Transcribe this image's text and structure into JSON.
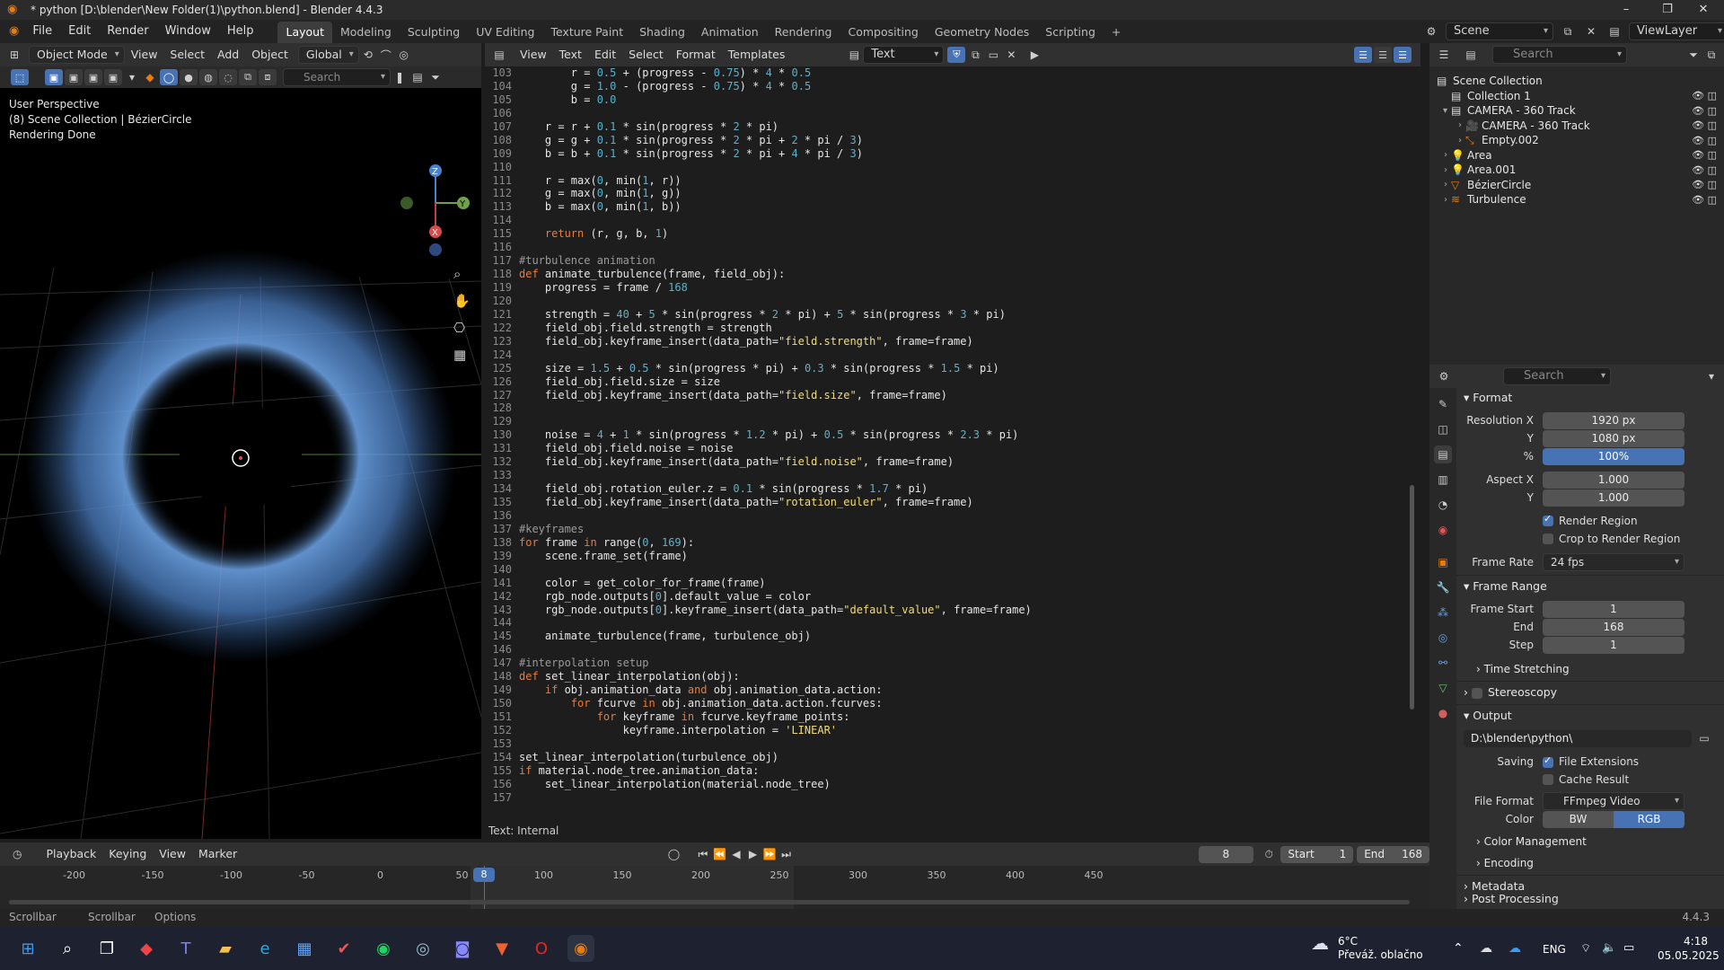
{
  "window": {
    "title": "* python [D:\\blender\\New Folder(1)\\python.blend] - Blender 4.4.3",
    "minimize": "–",
    "maximize": "❐",
    "close": "✕"
  },
  "menu": [
    "File",
    "Edit",
    "Render",
    "Window",
    "Help"
  ],
  "workspaces": [
    "Layout",
    "Modeling",
    "Sculpting",
    "UV Editing",
    "Texture Paint",
    "Shading",
    "Animation",
    "Rendering",
    "Compositing",
    "Geometry Nodes",
    "Scripting"
  ],
  "active_workspace": "Layout",
  "scene": {
    "label": "Scene",
    "view_layer": "ViewLayer"
  },
  "viewport": {
    "mode": "Object Mode",
    "menus": [
      "View",
      "Select",
      "Add",
      "Object"
    ],
    "orientation": "Global",
    "search_placeholder": "Search",
    "overlay_lines": [
      "User Perspective",
      "(8) Scene Collection | BézierCircle",
      "Rendering Done"
    ]
  },
  "text_editor": {
    "menus": [
      "View",
      "Text",
      "Edit",
      "Select",
      "Format",
      "Templates"
    ],
    "datablock": "Text",
    "footer": "Text: Internal"
  },
  "code_lines": [
    {
      "n": "103",
      "t": "        r = 0.5 + (progress - 0.75) * 4 * 0.5"
    },
    {
      "n": "104",
      "t": "        g = 1.0 - (progress - 0.75) * 4 * 0.5"
    },
    {
      "n": "105",
      "t": "        b = 0.0"
    },
    {
      "n": "106",
      "t": ""
    },
    {
      "n": "107",
      "t": "    r = r + 0.1 * sin(progress * 2 * pi)"
    },
    {
      "n": "108",
      "t": "    g = g + 0.1 * sin(progress * 2 * pi + 2 * pi / 3)"
    },
    {
      "n": "109",
      "t": "    b = b + 0.1 * sin(progress * 2 * pi + 4 * pi / 3)"
    },
    {
      "n": "110",
      "t": ""
    },
    {
      "n": "111",
      "t": "    r = max(0, min(1, r))"
    },
    {
      "n": "112",
      "t": "    g = max(0, min(1, g))"
    },
    {
      "n": "113",
      "t": "    b = max(0, min(1, b))"
    },
    {
      "n": "114",
      "t": ""
    },
    {
      "n": "115",
      "t": "    return (r, g, b, 1)"
    },
    {
      "n": "116",
      "t": ""
    },
    {
      "n": "117",
      "t": "#turbulence animation"
    },
    {
      "n": "118",
      "t": "def animate_turbulence(frame, field_obj):"
    },
    {
      "n": "119",
      "t": "    progress = frame / 168"
    },
    {
      "n": "120",
      "t": ""
    },
    {
      "n": "121",
      "t": "    strength = 40 + 5 * sin(progress * 2 * pi) + 5 * sin(progress * 3 * pi)"
    },
    {
      "n": "122",
      "t": "    field_obj.field.strength = strength"
    },
    {
      "n": "123",
      "t": "    field_obj.keyframe_insert(data_path=\"field.strength\", frame=frame)"
    },
    {
      "n": "124",
      "t": ""
    },
    {
      "n": "125",
      "t": "    size = 1.5 + 0.5 * sin(progress * pi) + 0.3 * sin(progress * 1.5 * pi)"
    },
    {
      "n": "126",
      "t": "    field_obj.field.size = size"
    },
    {
      "n": "127",
      "t": "    field_obj.keyframe_insert(data_path=\"field.size\", frame=frame)"
    },
    {
      "n": "128",
      "t": ""
    },
    {
      "n": "129",
      "t": ""
    },
    {
      "n": "130",
      "t": "    noise = 4 + 1 * sin(progress * 1.2 * pi) + 0.5 * sin(progress * 2.3 * pi)"
    },
    {
      "n": "131",
      "t": "    field_obj.field.noise = noise"
    },
    {
      "n": "132",
      "t": "    field_obj.keyframe_insert(data_path=\"field.noise\", frame=frame)"
    },
    {
      "n": "133",
      "t": ""
    },
    {
      "n": "134",
      "t": "    field_obj.rotation_euler.z = 0.1 * sin(progress * 1.7 * pi)"
    },
    {
      "n": "135",
      "t": "    field_obj.keyframe_insert(data_path=\"rotation_euler\", frame=frame)"
    },
    {
      "n": "136",
      "t": ""
    },
    {
      "n": "137",
      "t": "#keyframes"
    },
    {
      "n": "138",
      "t": "for frame in range(0, 169):"
    },
    {
      "n": "139",
      "t": "    scene.frame_set(frame)"
    },
    {
      "n": "140",
      "t": ""
    },
    {
      "n": "141",
      "t": "    color = get_color_for_frame(frame)"
    },
    {
      "n": "142",
      "t": "    rgb_node.outputs[0].default_value = color"
    },
    {
      "n": "143",
      "t": "    rgb_node.outputs[0].keyframe_insert(data_path=\"default_value\", frame=frame)"
    },
    {
      "n": "144",
      "t": ""
    },
    {
      "n": "145",
      "t": "    animate_turbulence(frame, turbulence_obj)"
    },
    {
      "n": "146",
      "t": ""
    },
    {
      "n": "147",
      "t": "#interpolation setup"
    },
    {
      "n": "148",
      "t": "def set_linear_interpolation(obj):"
    },
    {
      "n": "149",
      "t": "    if obj.animation_data and obj.animation_data.action:"
    },
    {
      "n": "150",
      "t": "        for fcurve in obj.animation_data.action.fcurves:"
    },
    {
      "n": "151",
      "t": "            for keyframe in fcurve.keyframe_points:"
    },
    {
      "n": "152",
      "t": "                keyframe.interpolation = 'LINEAR'"
    },
    {
      "n": "153",
      "t": ""
    },
    {
      "n": "154",
      "t": "set_linear_interpolation(turbulence_obj)"
    },
    {
      "n": "155",
      "t": "if material.node_tree.animation_data:"
    },
    {
      "n": "156",
      "t": "    set_linear_interpolation(material.node_tree)"
    },
    {
      "n": "157",
      "t": ""
    }
  ],
  "outliner": {
    "search_placeholder": "Search",
    "items": [
      {
        "label": "Scene Collection",
        "indent": 0
      },
      {
        "label": "Collection 1",
        "indent": 1
      },
      {
        "label": "CAMERA - 360 Track",
        "indent": 1
      },
      {
        "label": "CAMERA - 360 Track",
        "indent": 2
      },
      {
        "label": "Empty.002",
        "indent": 2
      },
      {
        "label": "Area",
        "indent": 1
      },
      {
        "label": "Area.001",
        "indent": 1
      },
      {
        "label": "BézierCircle",
        "indent": 1
      },
      {
        "label": "Turbulence",
        "indent": 1
      }
    ]
  },
  "properties": {
    "search_placeholder": "Search",
    "format_title": "Format",
    "resolution_x_label": "Resolution X",
    "resolution_x": "1920 px",
    "y_label": "Y",
    "resolution_y": "1080 px",
    "pct_label": "%",
    "resolution_pct": "100%",
    "aspect_x_label": "Aspect X",
    "aspect_x": "1.000",
    "aspect_y": "1.000",
    "render_region": "Render Region",
    "crop_region": "Crop to Render Region",
    "frame_rate_label": "Frame Rate",
    "frame_rate": "24 fps",
    "frame_range_title": "Frame Range",
    "frame_start_label": "Frame Start",
    "frame_start": "1",
    "end_label": "End",
    "frame_end": "168",
    "step_label": "Step",
    "frame_step": "1",
    "time_stretching": "Time Stretching",
    "stereoscopy": "Stereoscopy",
    "output_title": "Output",
    "output_path": "D:\\blender\\python\\",
    "saving_label": "Saving",
    "file_extensions": "File Extensions",
    "cache_result": "Cache Result",
    "file_format_label": "File Format",
    "file_format": "FFmpeg Video",
    "color_label": "Color",
    "color_bw": "BW",
    "color_rgb": "RGB",
    "color_management": "Color Management",
    "encoding": "Encoding",
    "metadata": "Metadata",
    "post_processing": "Post Processing"
  },
  "timeline": {
    "menus": [
      "Playback",
      "Keying",
      "View",
      "Marker"
    ],
    "current_frame": "8",
    "start_label": "Start",
    "start": "1",
    "end_label": "End",
    "end": "168",
    "ticks": [
      "-200",
      "-150",
      "-100",
      "-50",
      "0",
      "50",
      "100",
      "150",
      "200",
      "250",
      "300",
      "350",
      "400",
      "450"
    ]
  },
  "statusbar": {
    "items": [
      "Scrollbar",
      "Scrollbar",
      "Options"
    ],
    "version": "4.4.3"
  },
  "taskbar": {
    "weather_temp": "6°C",
    "weather_desc": "Převáž. oblačno",
    "lang": "ENG",
    "time": "4:18",
    "date": "05.05.2025"
  }
}
